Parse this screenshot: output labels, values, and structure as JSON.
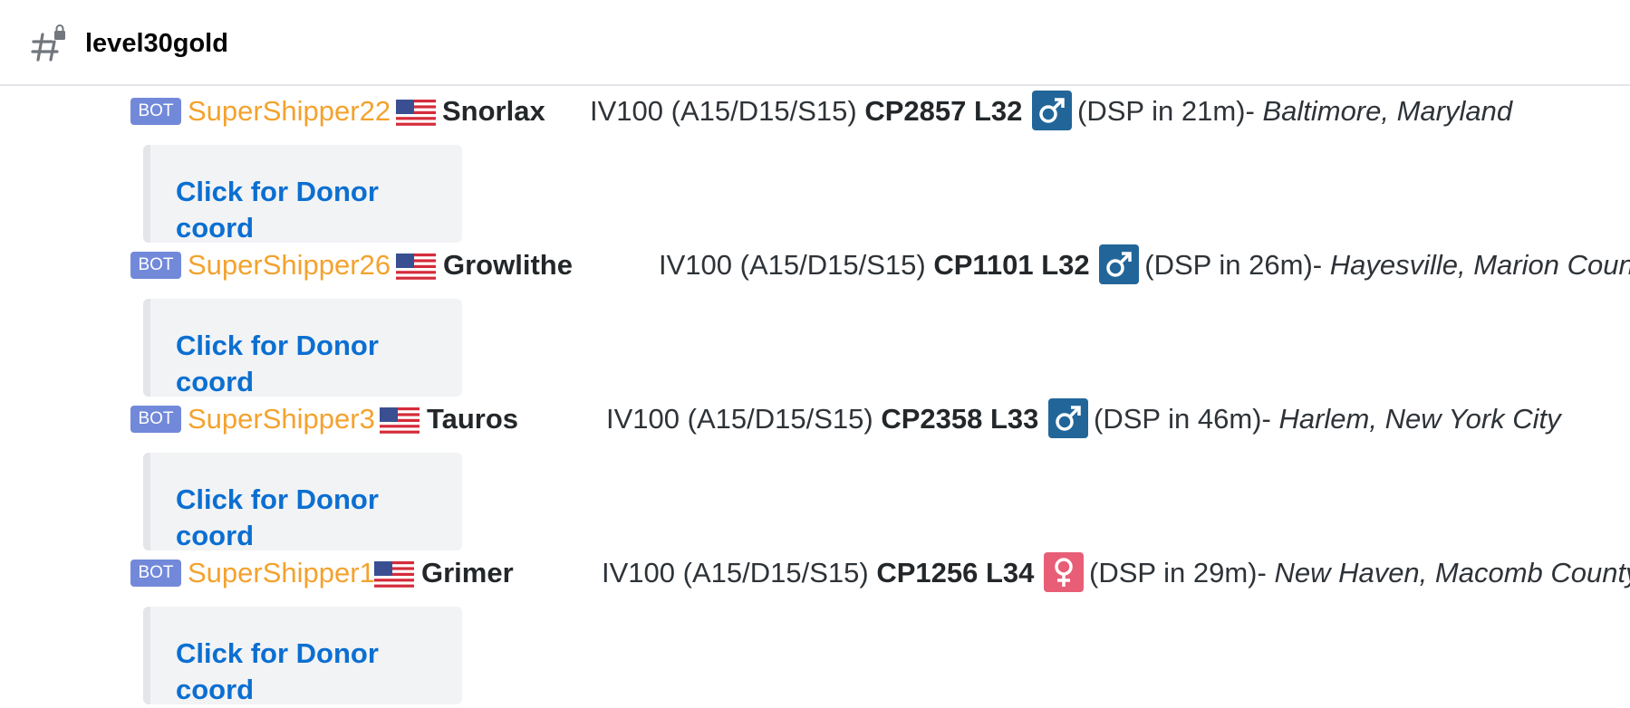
{
  "channel": {
    "name": "level30gold",
    "icon": "locked-hash-icon"
  },
  "messages": [
    {
      "bot_tag": "BOT",
      "username": "SuperShipper22",
      "flag": "us-flag-icon",
      "pokemon": "Snorlax",
      "iv_text": "IV100 (A15/D15/S15)",
      "cp_level": "CP2857 L32",
      "gender": "male",
      "dsp_text": "(DSP in 21m)-",
      "location": "Baltimore, Maryland",
      "link_label": "Click for Donor coord"
    },
    {
      "bot_tag": "BOT",
      "username": "SuperShipper26",
      "flag": "us-flag-icon",
      "pokemon": "Growlithe",
      "iv_text": "IV100 (A15/D15/S15)",
      "cp_level": "CP1101 L32",
      "gender": "male",
      "dsp_text": "(DSP in 26m)-",
      "location": "Hayesville, Marion County",
      "link_label": "Click for Donor coord"
    },
    {
      "bot_tag": "BOT",
      "username": "SuperShipper3",
      "flag": "us-flag-icon",
      "pokemon": "Tauros",
      "iv_text": "IV100 (A15/D15/S15)",
      "cp_level": "CP2358 L33",
      "gender": "male",
      "dsp_text": "(DSP in 46m)-",
      "location": "Harlem, New York City",
      "link_label": "Click for Donor coord"
    },
    {
      "bot_tag": "BOT",
      "username": "SuperShipper1",
      "flag": "us-flag-icon",
      "pokemon": "Grimer",
      "iv_text": "IV100 (A15/D15/S15)",
      "cp_level": "CP1256 L34",
      "gender": "female",
      "dsp_text": "(DSP in 29m)-",
      "location": "New Haven, Macomb County",
      "link_label": "Click for Donor coord"
    }
  ],
  "colors": {
    "username": "#f4a22e",
    "bot_tag": "#7289da",
    "link": "#0b6fd1",
    "male": "#226699",
    "female": "#e85e76"
  }
}
